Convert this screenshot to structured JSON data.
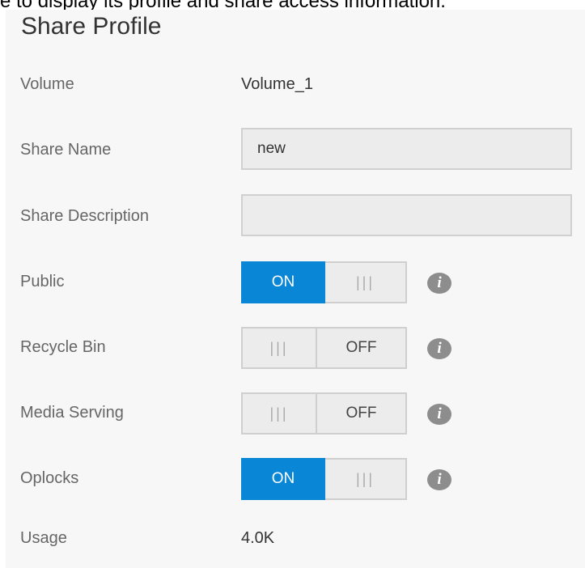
{
  "page": {
    "intro_text": "e to display its profile and share access information."
  },
  "profile": {
    "title": "Share Profile",
    "volume": {
      "label": "Volume",
      "value": "Volume_1"
    },
    "share_name": {
      "label": "Share Name",
      "value": "new"
    },
    "share_description": {
      "label": "Share Description",
      "value": ""
    },
    "public": {
      "label": "Public",
      "state": "ON",
      "grip": "|||"
    },
    "recycle_bin": {
      "label": "Recycle Bin",
      "state": "OFF",
      "grip": "|||"
    },
    "media_serving": {
      "label": "Media Serving",
      "state": "OFF",
      "grip": "|||"
    },
    "oplocks": {
      "label": "Oplocks",
      "state": "ON",
      "grip": "|||"
    },
    "usage": {
      "label": "Usage",
      "value": "4.0K"
    },
    "info_icon_glyph": "i"
  },
  "colors": {
    "accent": "#0a86d6",
    "panel_bg": "#f7f7f7",
    "info_icon": "#8d8d8d"
  }
}
